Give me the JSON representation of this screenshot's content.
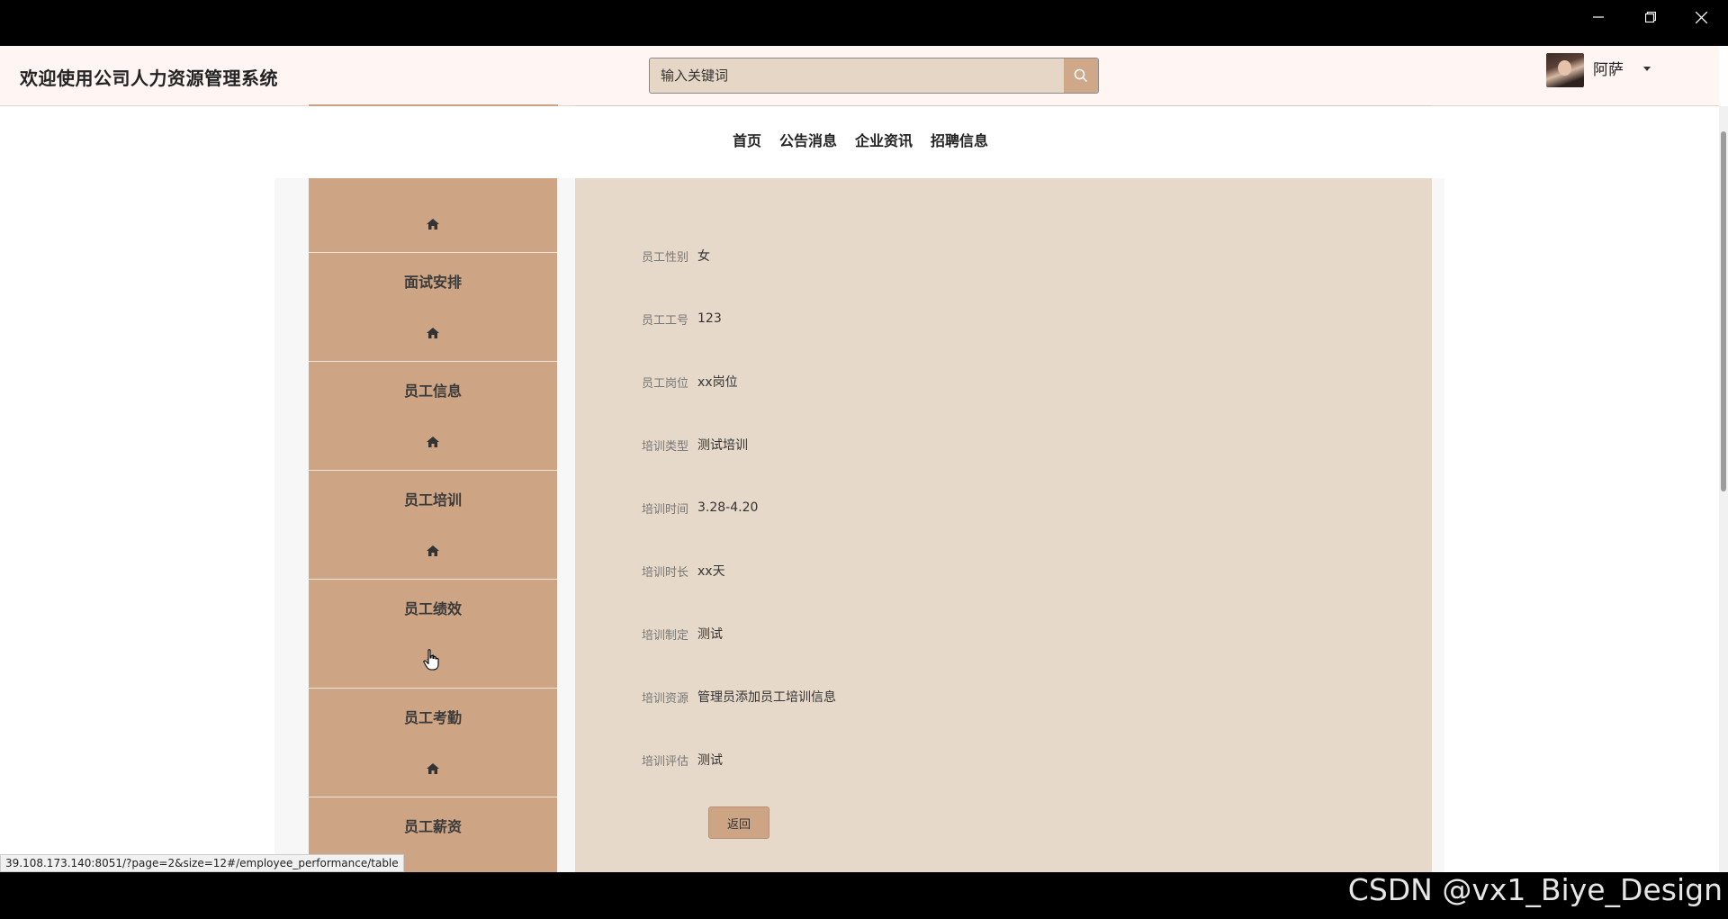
{
  "header": {
    "brand": "欢迎使用公司人力资源管理系统",
    "search_placeholder": "输入关键词",
    "username": "阿萨"
  },
  "nav": {
    "links": [
      "首页",
      "公告消息",
      "企业资讯",
      "招聘信息"
    ]
  },
  "sidebar": {
    "items": [
      "面试安排",
      "员工信息",
      "员工培训",
      "员工绩效",
      "员工考勤",
      "员工薪资"
    ]
  },
  "detail": {
    "fields": [
      {
        "label": "员工性别",
        "value": "女"
      },
      {
        "label": "员工工号",
        "value": "123"
      },
      {
        "label": "员工岗位",
        "value": "xx岗位"
      },
      {
        "label": "培训类型",
        "value": "测试培训"
      },
      {
        "label": "培训时间",
        "value": "3.28-4.20"
      },
      {
        "label": "培训时长",
        "value": "xx天"
      },
      {
        "label": "培训制定",
        "value": "测试"
      },
      {
        "label": "培训资源",
        "value": "管理员添加员工培训信息"
      },
      {
        "label": "培训评估",
        "value": "测试"
      }
    ],
    "back_label": "返回"
  },
  "status_url": "39.108.173.140:8051/?page=2&size=12#/employee_performance/table",
  "watermark": "CSDN @vx1_Biye_Design",
  "icons": {
    "search": "search-icon",
    "sidebar": "home-icon",
    "window": [
      "minimize-icon",
      "restore-icon",
      "close-icon"
    ]
  },
  "colors": {
    "accent": "#cea584",
    "content_bg": "#e6d9ca",
    "header_bg": "#fff6f3"
  }
}
